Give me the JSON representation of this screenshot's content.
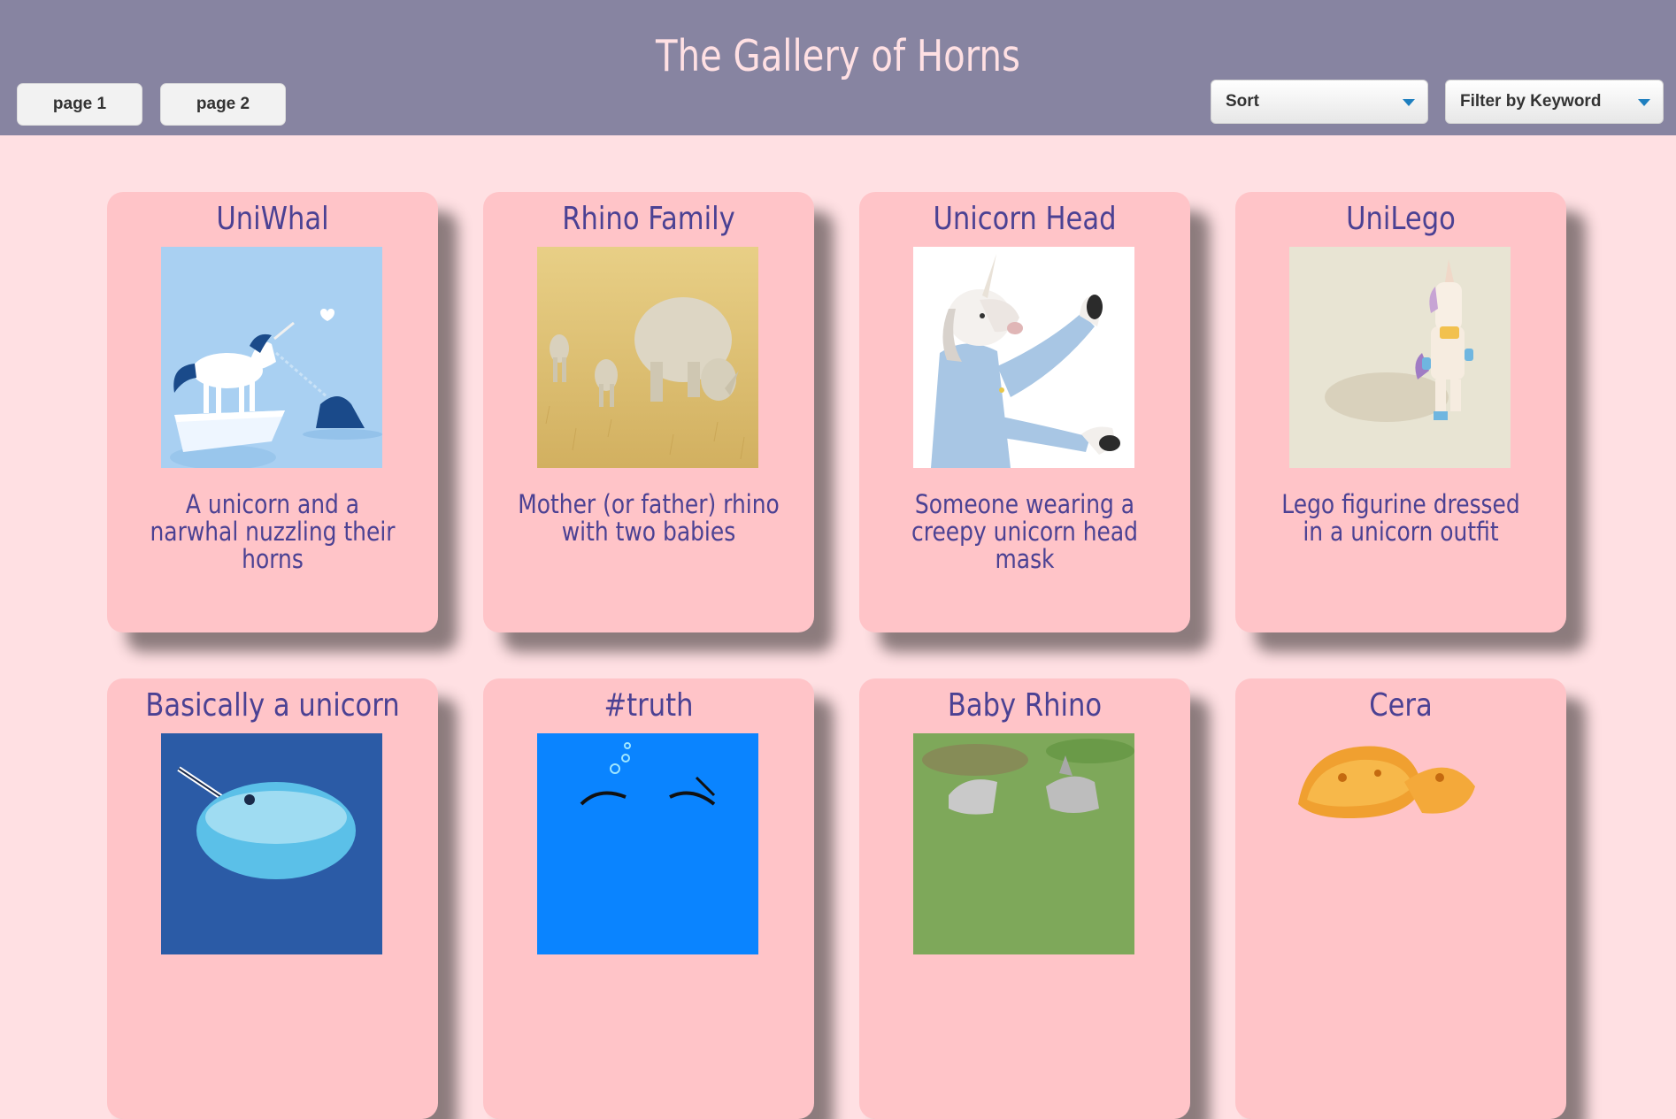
{
  "header": {
    "title": "The Gallery of Horns",
    "page_buttons": [
      "page 1",
      "page 2"
    ],
    "sort_label": "Sort",
    "filter_label": "Filter by Keyword"
  },
  "cards": [
    {
      "title": "UniWhal",
      "description": "A unicorn and a narwhal nuzzling their horns",
      "image": "unicorn-narwhal-illustration"
    },
    {
      "title": "Rhino Family",
      "description": "Mother (or father) rhino with two babies",
      "image": "rhino-family-photo"
    },
    {
      "title": "Unicorn Head",
      "description": "Someone wearing a creepy unicorn head mask",
      "image": "unicorn-mask-photo"
    },
    {
      "title": "UniLego",
      "description": "Lego figurine dressed in a unicorn outfit",
      "image": "lego-unicorn-photo"
    },
    {
      "title": "Basically a unicorn",
      "description": "",
      "image": "narwhal-illustration"
    },
    {
      "title": "#truth",
      "description": "",
      "image": "narwhal-cartoon"
    },
    {
      "title": "Baby Rhino",
      "description": "",
      "image": "baby-rhino-photo"
    },
    {
      "title": "Cera",
      "description": "",
      "image": "triceratops-toy"
    }
  ],
  "colors": {
    "header_bg": "#8784a1",
    "page_bg": "#ffe0e3",
    "card_bg": "#ffc4c8",
    "text": "#4b4193",
    "title": "#ffe0e3"
  }
}
